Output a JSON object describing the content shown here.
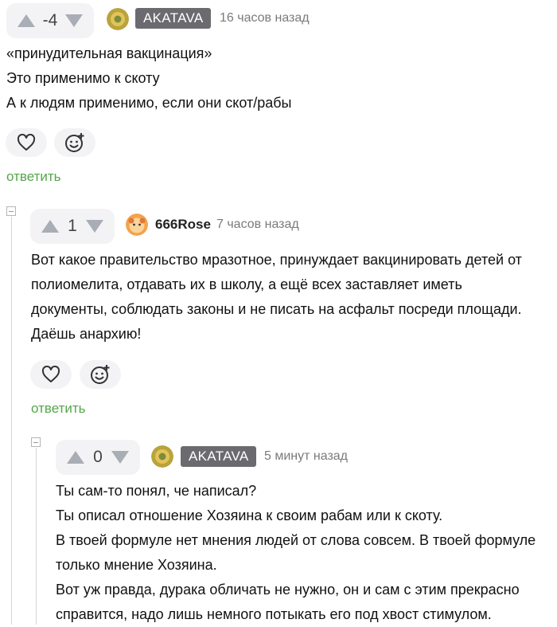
{
  "comments": [
    {
      "score": "-4",
      "author": "AKATAVA",
      "time": "16 часов назад",
      "lines": [
        "«принудительная вакцинация»",
        "Это применимо к скоту",
        "А к людям применимо, если они скот/рабы"
      ],
      "reply_label": "ответить"
    },
    {
      "score": "1",
      "author": "666Rose",
      "time": "7 часов назад",
      "lines": [
        "Вот какое правительство мразотное, принуждает вакцинировать детей от",
        "полиомелита, отдавать их в школу, а ещё всех заставляет иметь",
        "документы, соблюдать законы и не писать на асфальт посреди площади.",
        "Даёшь анархию!"
      ],
      "reply_label": "ответить"
    },
    {
      "score": "0",
      "author": "AKATAVA",
      "time": "5 минут назад",
      "lines": [
        "Ты сам-то понял, че написал?",
        "Ты описал отношение Хозяина к своим рабам или к скоту.",
        "В твоей формуле нет мнения людей от слова совсем. В твоей формуле",
        "только мнение Хозяина.",
        "Вот уж правда, дурака обличать не нужно, он и сам с этим прекрасно",
        "справится, надо лишь немного потыкать его под хвост стимулом."
      ]
    }
  ],
  "colors": {
    "reply": "#54a64a",
    "badge": "#6b6b6f",
    "vote_bg": "#f3f3f5"
  }
}
